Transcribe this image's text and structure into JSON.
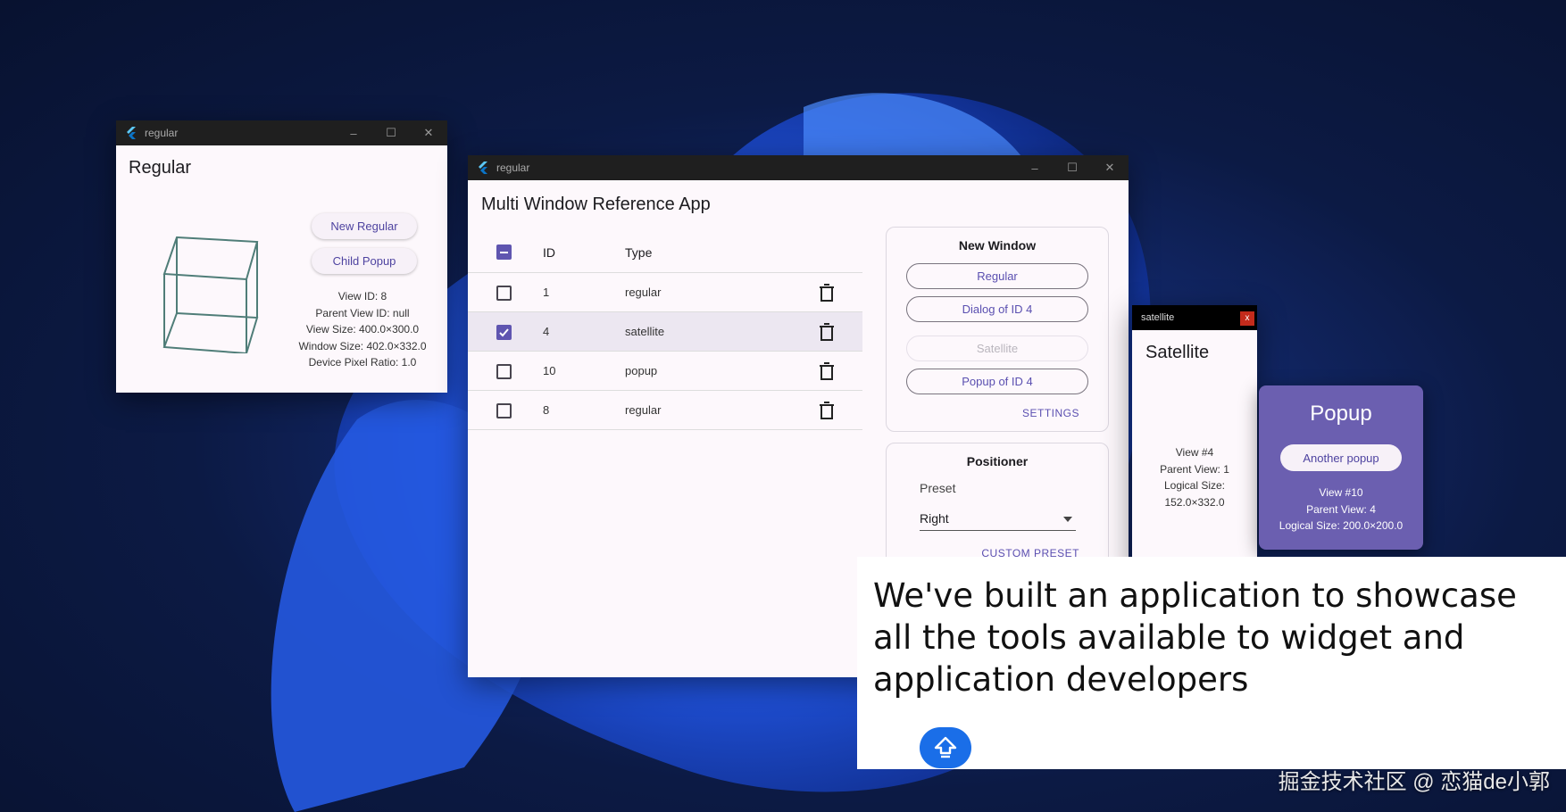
{
  "regular_window": {
    "titlebar": "regular",
    "title": "Regular",
    "buttons": {
      "new_regular": "New Regular",
      "child_popup": "Child Popup"
    },
    "info": [
      "View ID: 8",
      "Parent View ID: null",
      "View Size: 400.0×300.0",
      "Window Size: 402.0×332.0",
      "Device Pixel Ratio: 1.0"
    ]
  },
  "main_window": {
    "titlebar": "regular",
    "title": "Multi Window Reference App",
    "table": {
      "headers": {
        "id": "ID",
        "type": "Type"
      },
      "rows": [
        {
          "id": "1",
          "type": "regular",
          "selected": false
        },
        {
          "id": "4",
          "type": "satellite",
          "selected": true
        },
        {
          "id": "10",
          "type": "popup",
          "selected": false
        },
        {
          "id": "8",
          "type": "regular",
          "selected": false
        }
      ]
    },
    "new_window": {
      "heading": "New Window",
      "regular": "Regular",
      "dialog": "Dialog of ID 4",
      "satellite": "Satellite",
      "popup": "Popup of ID 4",
      "settings": "SETTINGS"
    },
    "positioner": {
      "heading": "Positioner",
      "preset_label": "Preset",
      "preset_value": "Right",
      "custom": "CUSTOM PRESET"
    }
  },
  "satellite_window": {
    "titlebar": "satellite",
    "close": "x",
    "title": "Satellite",
    "info": [
      "View #4",
      "Parent View: 1",
      "Logical Size:",
      "152.0×332.0"
    ]
  },
  "popup_window": {
    "title": "Popup",
    "button": "Another popup",
    "info": [
      "View #10",
      "Parent View: 4",
      "Logical Size: 200.0×200.0"
    ]
  },
  "caption": {
    "text": "We've built an application to showcase all the tools available to widget and application developers"
  },
  "watermark": "掘金技术社区 @ 恋猫de小郭",
  "colors": {
    "accent": "#5f55b0",
    "popup_bg": "#6b5fb0",
    "fab": "#1a6ee8"
  }
}
